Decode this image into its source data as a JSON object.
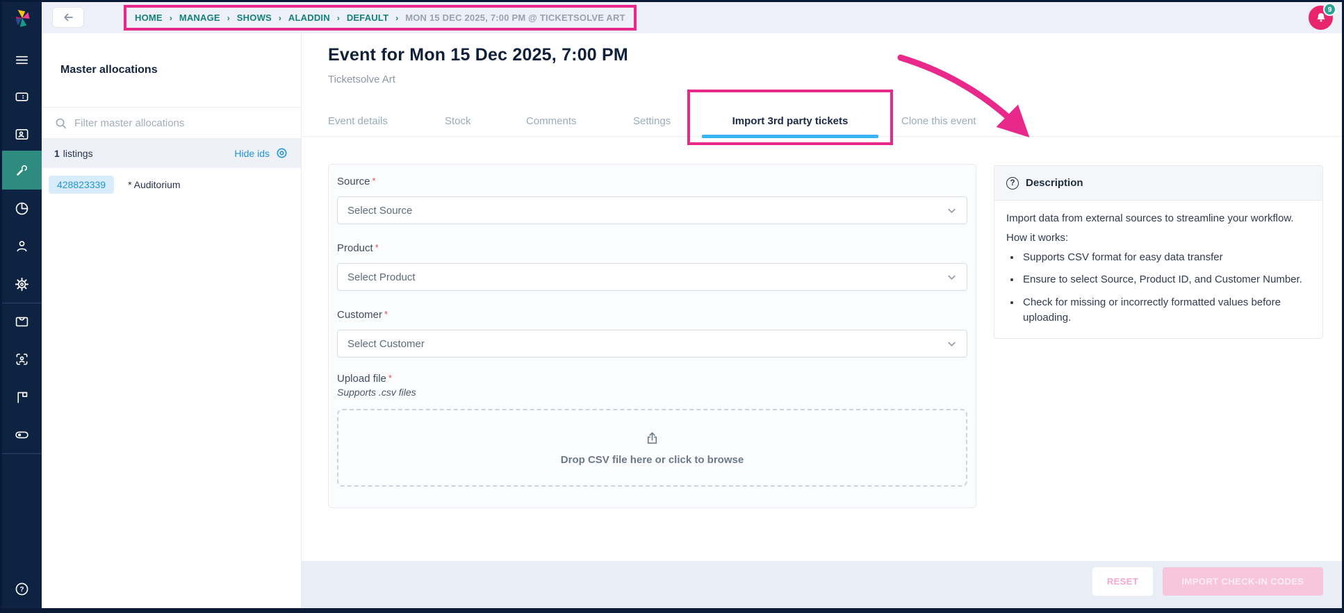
{
  "header": {
    "breadcrumb": [
      {
        "label": "HOME"
      },
      {
        "label": "MANAGE"
      },
      {
        "label": "SHOWS"
      },
      {
        "label": "ALADDIN"
      },
      {
        "label": "DEFAULT"
      },
      {
        "label": "MON 15 DEC 2025, 7:00 PM @ TICKETSOLVE ART"
      }
    ],
    "breadcrumb_separator": "›",
    "notification_count": "9"
  },
  "sidebar": {
    "icons": [
      "menu",
      "tickets",
      "contact-card",
      "tools",
      "reports",
      "customers",
      "settings",
      "inbox",
      "check-in",
      "boards",
      "toggle",
      "help"
    ],
    "active_item": "tools"
  },
  "allocations_panel": {
    "title": "Master allocations",
    "filter_placeholder": "Filter master allocations",
    "count": "1",
    "count_suffix": "listings",
    "hide_ids_label": "Hide ids",
    "listing": {
      "id": "428823339",
      "name": "* Auditorium"
    }
  },
  "main": {
    "title": "Event for Mon 15 Dec 2025, 7:00 PM",
    "subtitle": "Ticketsolve Art",
    "tabs": [
      {
        "label": "Event details"
      },
      {
        "label": "Stock"
      },
      {
        "label": "Comments"
      },
      {
        "label": "Settings"
      },
      {
        "label": "Import 3rd party tickets"
      },
      {
        "label": "Clone this event"
      }
    ],
    "active_tab": "Import 3rd party tickets",
    "form": {
      "required_marker": "*",
      "source_label": "Source",
      "source_placeholder": "Select Source",
      "product_label": "Product",
      "product_placeholder": "Select Product",
      "customer_label": "Customer",
      "customer_placeholder": "Select Customer",
      "upload_label": "Upload file",
      "upload_hint": "Supports .csv files",
      "dropzone_text": "Drop CSV file here or click to browse"
    },
    "description_panel": {
      "title": "Description",
      "intro": "Import data from external sources to streamline your workflow.",
      "how_it_works": "How it works:",
      "bullets": [
        "Supports CSV format for easy data transfer",
        "Ensure to select Source, Product ID, and Customer Number.",
        "Check for missing or incorrectly formatted values before uploading."
      ]
    },
    "footer": {
      "reset_label": "RESET",
      "import_label": "IMPORT CHECK-IN CODES"
    }
  },
  "colors": {
    "annotation_pink": "#e8288b",
    "breadcrumb_teal": "#15807a",
    "link_blue": "#2095d6",
    "active_tab_underline": "#39b4f2",
    "sidebar_navy": "#0e2242",
    "sidebar_active_teal": "#2e8b7f",
    "avatar_pink": "#e8256d",
    "badge_teal": "#2aa294",
    "footer_button_pink": "#f7c5dc"
  }
}
